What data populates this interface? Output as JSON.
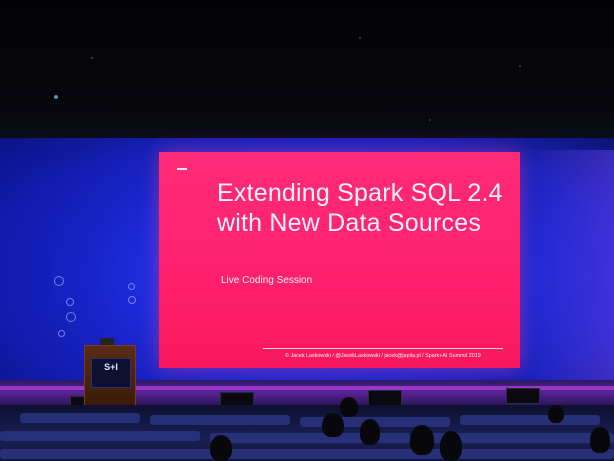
{
  "slide": {
    "title": "Extending Spark SQL 2.4 with New Data Sources",
    "subtitle": "Live Coding Session",
    "footer": "© Jacek Laskowski / @JacekLaskowski / jacek@japila.pl / Spark+AI Summit 2019"
  },
  "podium": {
    "logo": "S+I"
  },
  "colors": {
    "slide_background": "#ff1f6c",
    "backdrop_blue": "#2b3cff",
    "stage_purple": "#5a2398"
  }
}
